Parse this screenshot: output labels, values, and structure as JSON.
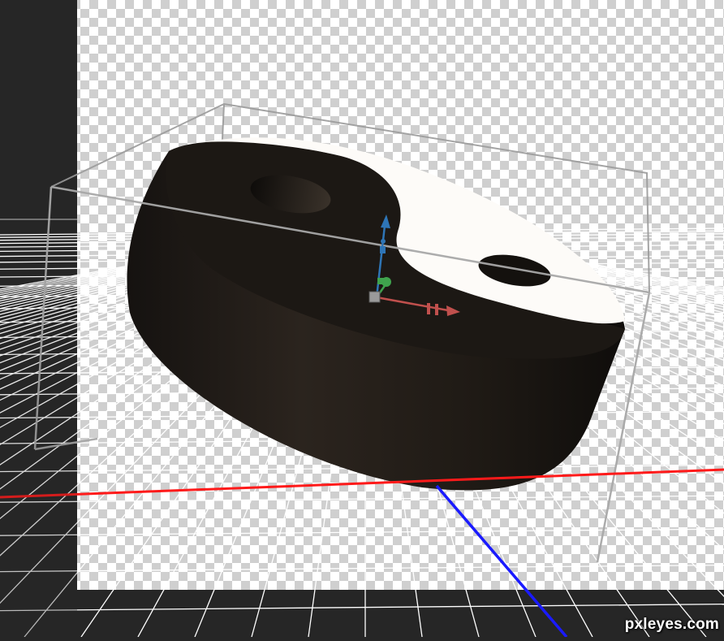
{
  "scene": {
    "object": "yin-yang-3d-model",
    "colors": {
      "workspace": "#262626",
      "canvas_checker_light": "#ffffff",
      "canvas_checker_dark": "#cfcfcf",
      "ground_grid": "#ffffff",
      "x_axis": "#ff1a1a",
      "z_axis": "#1a1aff",
      "object_dark": "#1c1814",
      "object_light": "#fdfbf8",
      "bounding_box": "#9a9a9a"
    },
    "widget": {
      "axes": [
        "x",
        "y",
        "z"
      ],
      "x_color": "#c0504d",
      "y_color": "#2e75b6",
      "z_color": "#3fa34d"
    }
  },
  "watermark": {
    "text": "pxleyes.com"
  }
}
